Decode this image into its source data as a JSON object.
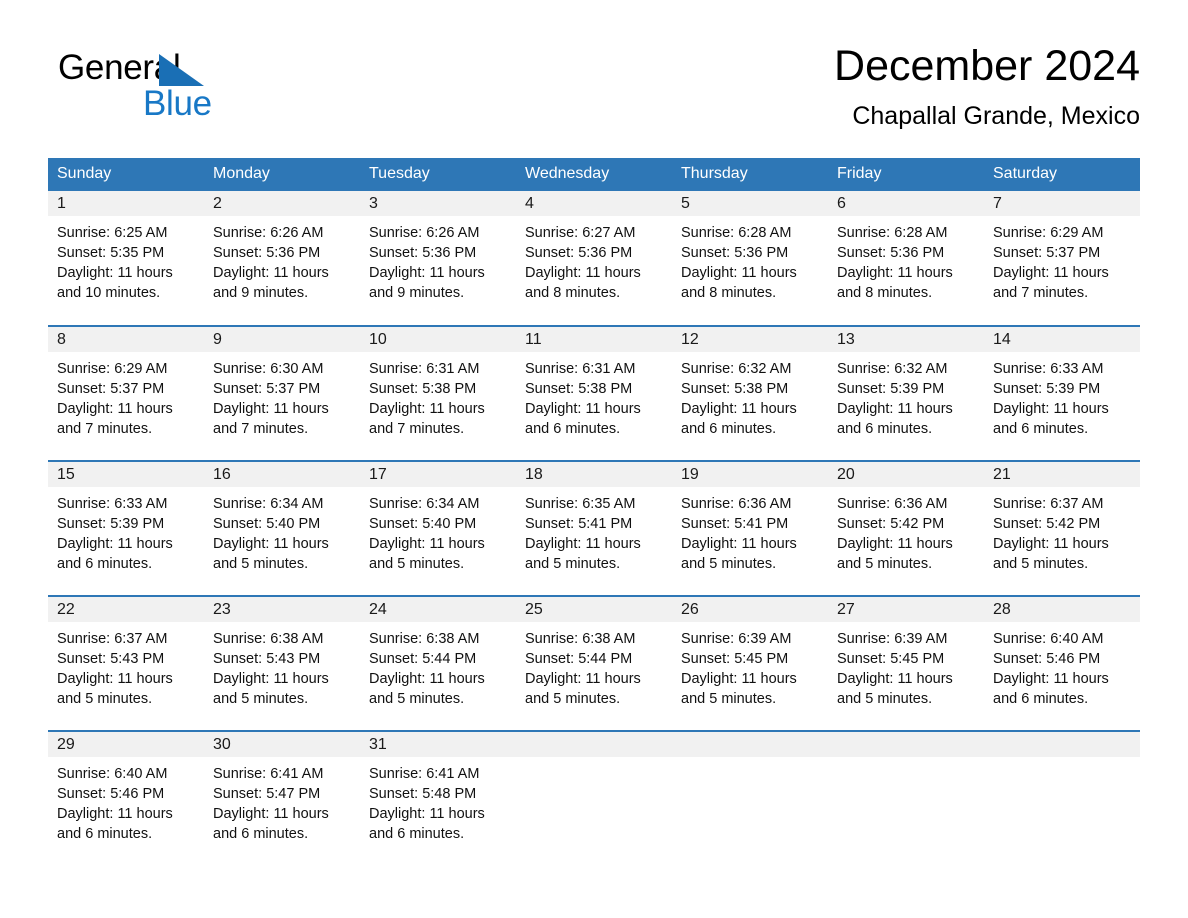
{
  "brand": {
    "line1": "General",
    "line2": "Blue",
    "triangle_color": "#1a6fb5",
    "blue_text_color": "#1878c6"
  },
  "header": {
    "title": "December 2024",
    "subtitle": "Chapallal Grande, Mexico"
  },
  "theme": {
    "header_row_bg": "#2e77b6",
    "header_row_text": "#ffffff",
    "daynum_bg": "#f1f1f1",
    "week_divider": "#2e77b6",
    "page_bg": "#ffffff"
  },
  "weekdays": [
    "Sunday",
    "Monday",
    "Tuesday",
    "Wednesday",
    "Thursday",
    "Friday",
    "Saturday"
  ],
  "labels": {
    "sunrise_prefix": "Sunrise:",
    "sunset_prefix": "Sunset:",
    "daylight_prefix": "Daylight:"
  },
  "weeks": [
    [
      {
        "day": "1",
        "sunrise": "Sunrise: 6:25 AM",
        "sunset": "Sunset: 5:35 PM",
        "daylight1": "Daylight: 11 hours",
        "daylight2": "and 10 minutes."
      },
      {
        "day": "2",
        "sunrise": "Sunrise: 6:26 AM",
        "sunset": "Sunset: 5:36 PM",
        "daylight1": "Daylight: 11 hours",
        "daylight2": "and 9 minutes."
      },
      {
        "day": "3",
        "sunrise": "Sunrise: 6:26 AM",
        "sunset": "Sunset: 5:36 PM",
        "daylight1": "Daylight: 11 hours",
        "daylight2": "and 9 minutes."
      },
      {
        "day": "4",
        "sunrise": "Sunrise: 6:27 AM",
        "sunset": "Sunset: 5:36 PM",
        "daylight1": "Daylight: 11 hours",
        "daylight2": "and 8 minutes."
      },
      {
        "day": "5",
        "sunrise": "Sunrise: 6:28 AM",
        "sunset": "Sunset: 5:36 PM",
        "daylight1": "Daylight: 11 hours",
        "daylight2": "and 8 minutes."
      },
      {
        "day": "6",
        "sunrise": "Sunrise: 6:28 AM",
        "sunset": "Sunset: 5:36 PM",
        "daylight1": "Daylight: 11 hours",
        "daylight2": "and 8 minutes."
      },
      {
        "day": "7",
        "sunrise": "Sunrise: 6:29 AM",
        "sunset": "Sunset: 5:37 PM",
        "daylight1": "Daylight: 11 hours",
        "daylight2": "and 7 minutes."
      }
    ],
    [
      {
        "day": "8",
        "sunrise": "Sunrise: 6:29 AM",
        "sunset": "Sunset: 5:37 PM",
        "daylight1": "Daylight: 11 hours",
        "daylight2": "and 7 minutes."
      },
      {
        "day": "9",
        "sunrise": "Sunrise: 6:30 AM",
        "sunset": "Sunset: 5:37 PM",
        "daylight1": "Daylight: 11 hours",
        "daylight2": "and 7 minutes."
      },
      {
        "day": "10",
        "sunrise": "Sunrise: 6:31 AM",
        "sunset": "Sunset: 5:38 PM",
        "daylight1": "Daylight: 11 hours",
        "daylight2": "and 7 minutes."
      },
      {
        "day": "11",
        "sunrise": "Sunrise: 6:31 AM",
        "sunset": "Sunset: 5:38 PM",
        "daylight1": "Daylight: 11 hours",
        "daylight2": "and 6 minutes."
      },
      {
        "day": "12",
        "sunrise": "Sunrise: 6:32 AM",
        "sunset": "Sunset: 5:38 PM",
        "daylight1": "Daylight: 11 hours",
        "daylight2": "and 6 minutes."
      },
      {
        "day": "13",
        "sunrise": "Sunrise: 6:32 AM",
        "sunset": "Sunset: 5:39 PM",
        "daylight1": "Daylight: 11 hours",
        "daylight2": "and 6 minutes."
      },
      {
        "day": "14",
        "sunrise": "Sunrise: 6:33 AM",
        "sunset": "Sunset: 5:39 PM",
        "daylight1": "Daylight: 11 hours",
        "daylight2": "and 6 minutes."
      }
    ],
    [
      {
        "day": "15",
        "sunrise": "Sunrise: 6:33 AM",
        "sunset": "Sunset: 5:39 PM",
        "daylight1": "Daylight: 11 hours",
        "daylight2": "and 6 minutes."
      },
      {
        "day": "16",
        "sunrise": "Sunrise: 6:34 AM",
        "sunset": "Sunset: 5:40 PM",
        "daylight1": "Daylight: 11 hours",
        "daylight2": "and 5 minutes."
      },
      {
        "day": "17",
        "sunrise": "Sunrise: 6:34 AM",
        "sunset": "Sunset: 5:40 PM",
        "daylight1": "Daylight: 11 hours",
        "daylight2": "and 5 minutes."
      },
      {
        "day": "18",
        "sunrise": "Sunrise: 6:35 AM",
        "sunset": "Sunset: 5:41 PM",
        "daylight1": "Daylight: 11 hours",
        "daylight2": "and 5 minutes."
      },
      {
        "day": "19",
        "sunrise": "Sunrise: 6:36 AM",
        "sunset": "Sunset: 5:41 PM",
        "daylight1": "Daylight: 11 hours",
        "daylight2": "and 5 minutes."
      },
      {
        "day": "20",
        "sunrise": "Sunrise: 6:36 AM",
        "sunset": "Sunset: 5:42 PM",
        "daylight1": "Daylight: 11 hours",
        "daylight2": "and 5 minutes."
      },
      {
        "day": "21",
        "sunrise": "Sunrise: 6:37 AM",
        "sunset": "Sunset: 5:42 PM",
        "daylight1": "Daylight: 11 hours",
        "daylight2": "and 5 minutes."
      }
    ],
    [
      {
        "day": "22",
        "sunrise": "Sunrise: 6:37 AM",
        "sunset": "Sunset: 5:43 PM",
        "daylight1": "Daylight: 11 hours",
        "daylight2": "and 5 minutes."
      },
      {
        "day": "23",
        "sunrise": "Sunrise: 6:38 AM",
        "sunset": "Sunset: 5:43 PM",
        "daylight1": "Daylight: 11 hours",
        "daylight2": "and 5 minutes."
      },
      {
        "day": "24",
        "sunrise": "Sunrise: 6:38 AM",
        "sunset": "Sunset: 5:44 PM",
        "daylight1": "Daylight: 11 hours",
        "daylight2": "and 5 minutes."
      },
      {
        "day": "25",
        "sunrise": "Sunrise: 6:38 AM",
        "sunset": "Sunset: 5:44 PM",
        "daylight1": "Daylight: 11 hours",
        "daylight2": "and 5 minutes."
      },
      {
        "day": "26",
        "sunrise": "Sunrise: 6:39 AM",
        "sunset": "Sunset: 5:45 PM",
        "daylight1": "Daylight: 11 hours",
        "daylight2": "and 5 minutes."
      },
      {
        "day": "27",
        "sunrise": "Sunrise: 6:39 AM",
        "sunset": "Sunset: 5:45 PM",
        "daylight1": "Daylight: 11 hours",
        "daylight2": "and 5 minutes."
      },
      {
        "day": "28",
        "sunrise": "Sunrise: 6:40 AM",
        "sunset": "Sunset: 5:46 PM",
        "daylight1": "Daylight: 11 hours",
        "daylight2": "and 6 minutes."
      }
    ],
    [
      {
        "day": "29",
        "sunrise": "Sunrise: 6:40 AM",
        "sunset": "Sunset: 5:46 PM",
        "daylight1": "Daylight: 11 hours",
        "daylight2": "and 6 minutes."
      },
      {
        "day": "30",
        "sunrise": "Sunrise: 6:41 AM",
        "sunset": "Sunset: 5:47 PM",
        "daylight1": "Daylight: 11 hours",
        "daylight2": "and 6 minutes."
      },
      {
        "day": "31",
        "sunrise": "Sunrise: 6:41 AM",
        "sunset": "Sunset: 5:48 PM",
        "daylight1": "Daylight: 11 hours",
        "daylight2": "and 6 minutes."
      },
      {
        "day": "",
        "sunrise": "",
        "sunset": "",
        "daylight1": "",
        "daylight2": ""
      },
      {
        "day": "",
        "sunrise": "",
        "sunset": "",
        "daylight1": "",
        "daylight2": ""
      },
      {
        "day": "",
        "sunrise": "",
        "sunset": "",
        "daylight1": "",
        "daylight2": ""
      },
      {
        "day": "",
        "sunrise": "",
        "sunset": "",
        "daylight1": "",
        "daylight2": ""
      }
    ]
  ]
}
